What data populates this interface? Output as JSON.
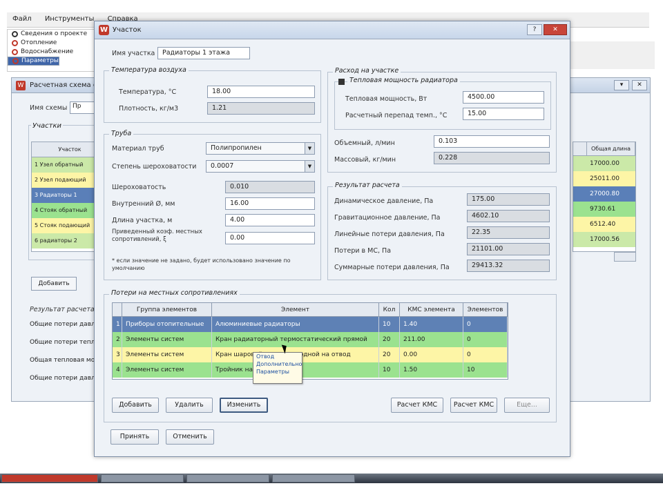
{
  "background": {
    "menu": [
      "Файл",
      "Инструменты",
      "Справка"
    ],
    "menu_items": [
      "Сведения о проекте",
      "Отопление",
      "Водоснабжение",
      "Параметры"
    ],
    "taskbar_items": 4
  },
  "win2": {
    "title": "Расчетная схема отопления",
    "field_label": "Имя схемы",
    "field_value": "Пр",
    "group_title": "Участки",
    "col_header": "Участок",
    "rows": [
      "1 Узел обратный",
      "2 Узел подающий",
      "3 Радиаторы 1",
      "4 Стояк обратный",
      "5 Стояк подающий",
      "6 радиаторы 2"
    ],
    "row_colors": [
      "#cbe9a8",
      "#fdf5a6",
      "#5a7fb8",
      "#9be28f",
      "#fdf5a6",
      "#cbe9a8"
    ],
    "add_button": "Добавить",
    "results_title": "Результат расчета",
    "results": [
      "Общие потери давления",
      "Общие потери тепла",
      "Общая тепловая мощность",
      "Общие потери давления"
    ],
    "right_header": "Общая длина",
    "right_values": [
      "17000.00",
      "25011.00",
      "27000.80",
      "9730.61",
      "6512.40",
      "17000.56"
    ]
  },
  "dialog": {
    "title": "Участок",
    "name_label": "Имя участка",
    "name_value": "Радиаторы 1 этажа",
    "temp_group": "Температура воздуха",
    "temp_label": "Температура, °С",
    "temp_value": "18.00",
    "density_label": "Плотность, кг/м3",
    "density_value": "1.21",
    "pipe_group": "Труба",
    "material_label": "Материал труб",
    "material_value": "Полипропилен",
    "roughness_label": "Степень шероховатости",
    "roughness_value": "0.0007",
    "rough_label": "Шероховатость",
    "rough_value": "0.010",
    "diameter_label": "Внутренний Ø, мм",
    "diameter_value": "16.00",
    "length_label": "Длина участка, м",
    "length_value": "4.00",
    "equiv_label": "Приведенный коэф. местных сопротивлений, ξ",
    "equiv_value": "0.00",
    "note": "* если значение не задано, будет использовано значение по умолчанию",
    "flow_group": "Расход на участке",
    "flow_check": "Тепловая мощность радиатора",
    "power_label": "Тепловая мощность, Вт",
    "power_value": "4500.00",
    "delta_label": "Расчетный перепад темп., °С",
    "delta_value": "15.00",
    "volume_label": "Объемный, л/мин",
    "volume_value": "0.103",
    "mass_label": "Массовый, кг/мин",
    "mass_value": "0.228",
    "calc_group": "Результат расчета",
    "calc": [
      {
        "label": "Динамическое давление, Па",
        "value": "175.00"
      },
      {
        "label": "Гравитационное давление, Па",
        "value": "4602.10"
      },
      {
        "label": "Линейные потери давления, Па",
        "value": "22.35"
      },
      {
        "label": "Потери в МС, Па",
        "value": "21101.00"
      },
      {
        "label": "Суммарные потери давления, Па",
        "value": "29413.32"
      }
    ],
    "local_group": "Потери на местных сопротивлениях",
    "table_headers": [
      "",
      "Группа элементов",
      "Элемент",
      "Кол",
      "КМС элемента",
      "Элементов"
    ],
    "table_rows": [
      {
        "n": "1",
        "group": "Приборы отопительные",
        "element": "Алюминиевые радиаторы",
        "qty": "10",
        "kms": "1.40",
        "count": "0",
        "bg": "#5e81b5",
        "fg": "#ffffff"
      },
      {
        "n": "2",
        "group": "Элементы систем",
        "element": "Кран радиаторный термостатический прямой",
        "qty": "20",
        "kms": "211.00",
        "count": "0",
        "bg": "#9be28f",
        "fg": "#222222"
      },
      {
        "n": "3",
        "group": "Элементы систем",
        "element": "Кран шаровой полнопроходной на отвод",
        "qty": "20",
        "kms": "0.00",
        "count": "0",
        "bg": "#fdf5a6",
        "fg": "#222222"
      },
      {
        "n": "4",
        "group": "Элементы систем",
        "element": "Тройник на ответвление",
        "qty": "10",
        "kms": "1.50",
        "count": "10",
        "bg": "#9be28f",
        "fg": "#222222"
      }
    ],
    "tooltip": [
      "Отвод",
      "Дополнительно",
      "Параметры"
    ],
    "btn_add": "Добавить",
    "btn_delete": "Удалить",
    "btn_change": "Изменить",
    "btn_calc_kms": "Расчет КМС",
    "btn_calc_p": "Расчет КМС",
    "btn_more": "Еще...",
    "btn_apply": "Принять",
    "btn_cancel": "Отменить"
  }
}
